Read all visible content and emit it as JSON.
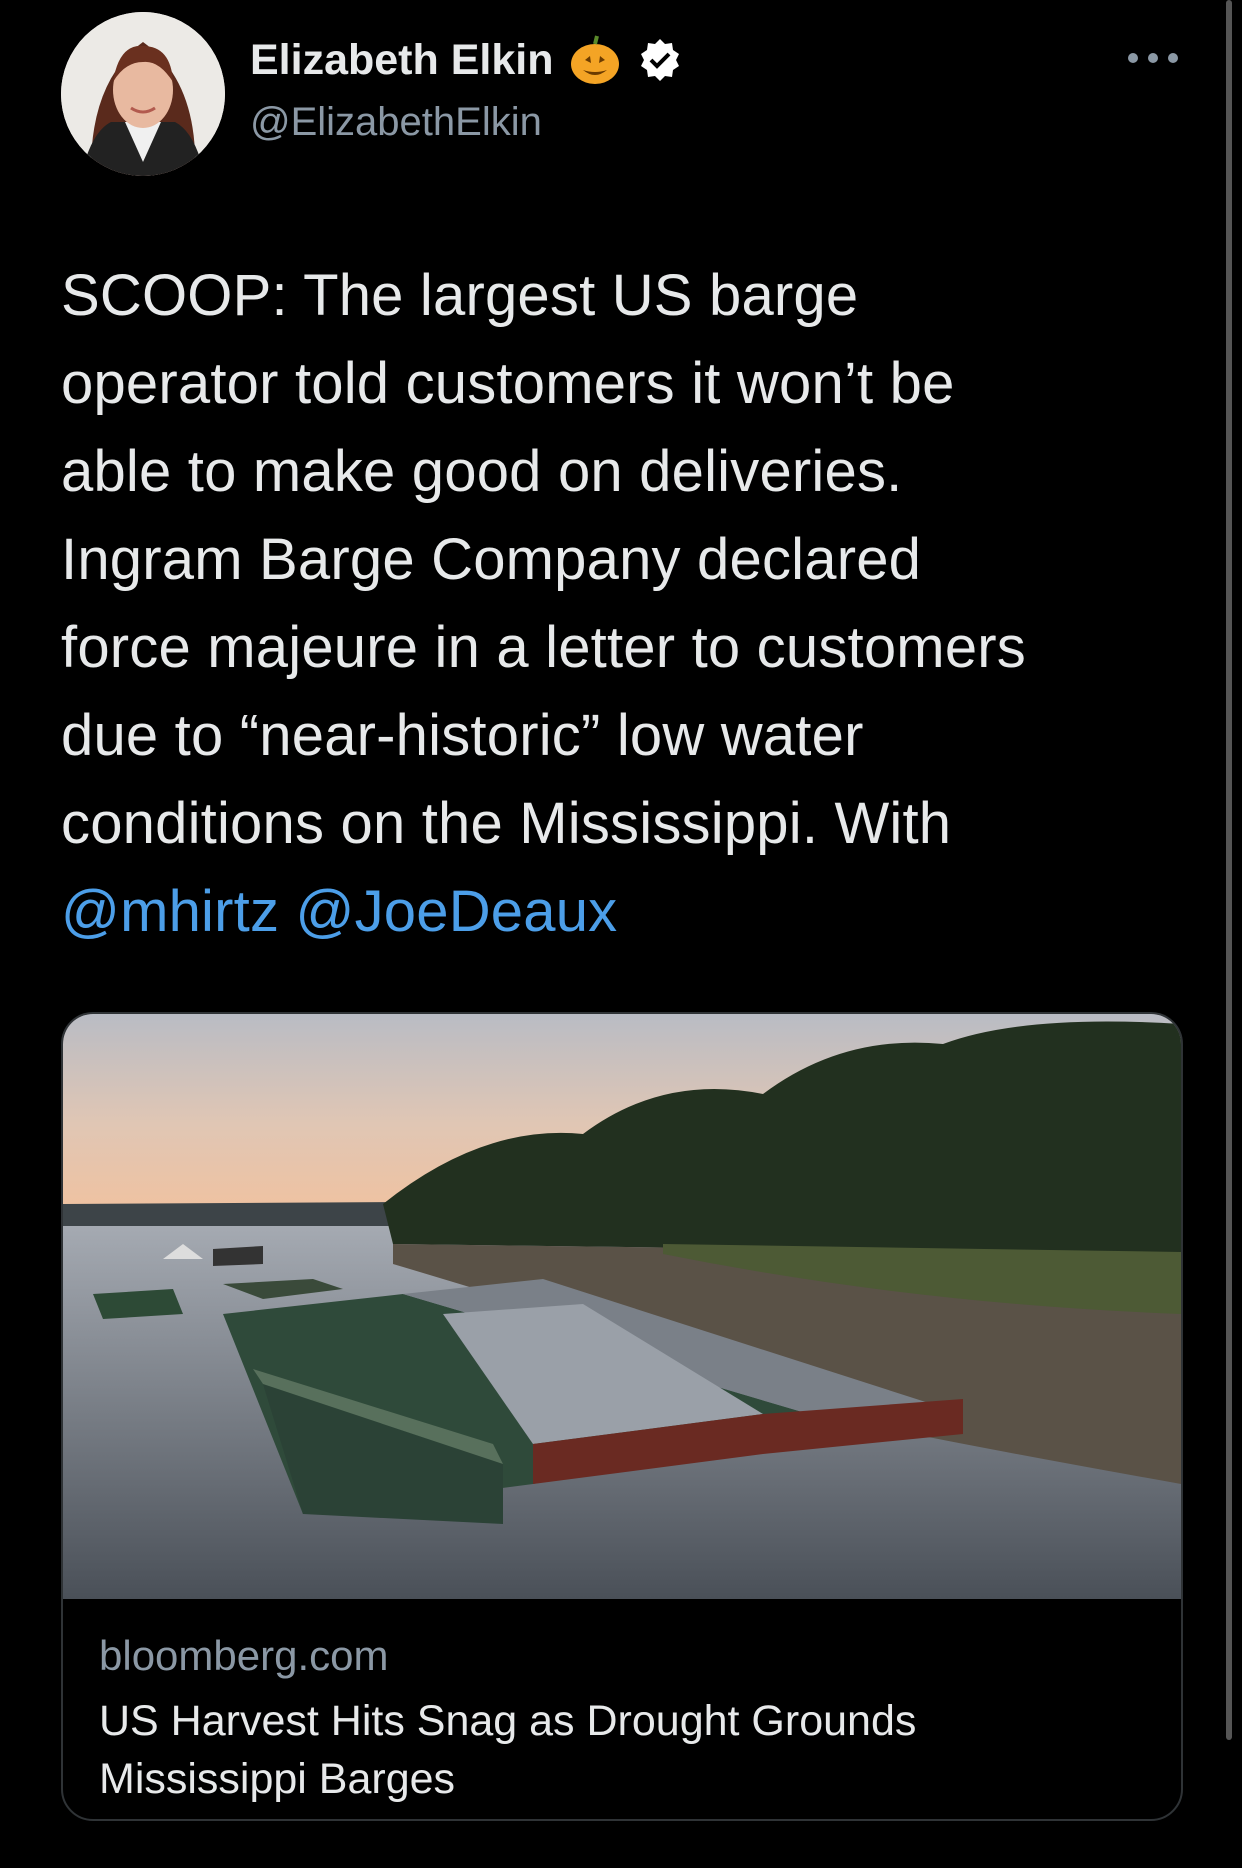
{
  "author": {
    "name": "Elizabeth Elkin",
    "handle": "@ElizabethElkin",
    "badge_icons": [
      "pumpkin-icon",
      "verified-icon"
    ]
  },
  "menu_icon": "more-options-icon",
  "tweet": {
    "lines": [
      "SCOOP: The largest US barge",
      "operator told customers it won’t be",
      "able to make good on deliveries.",
      "Ingram Barge Company declared",
      "force majeure in a letter to customers",
      "due to “near-historic” low water",
      "conditions on the Mississippi. With"
    ],
    "mentions": [
      "@mhirtz",
      "@JoeDeaux"
    ]
  },
  "link_card": {
    "domain": "bloomberg.com",
    "title_lines": [
      "US Harvest Hits Snag as Drought Grounds",
      "Mississippi Barges"
    ]
  },
  "colors": {
    "background": "#000000",
    "text": "#e7e9ea",
    "secondary": "#8b98a5",
    "link": "#4c9ee8",
    "border": "#2f3336"
  }
}
